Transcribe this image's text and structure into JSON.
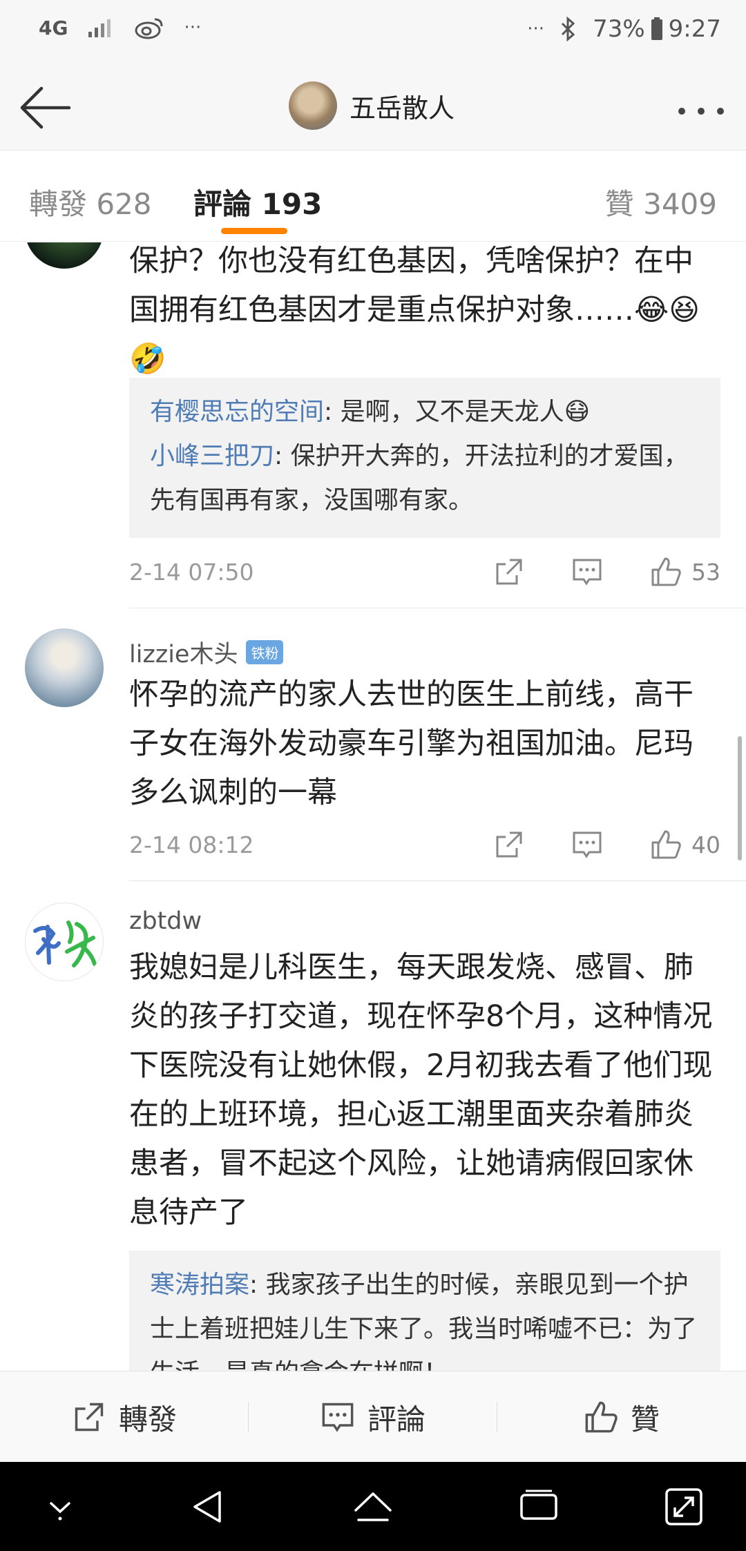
{
  "status_bar": {
    "network": "4G",
    "ellipsis_left": "···",
    "ellipsis_right": "···",
    "battery": "73%",
    "time": "9:27"
  },
  "header": {
    "title": "五岳散人"
  },
  "tabs": [
    {
      "label": "轉發 628"
    },
    {
      "label": "評論 193"
    },
    {
      "label": "贊 3409"
    }
  ],
  "comments": [
    {
      "text": "保护？你也没有红色基因，凭啥保护？在中国拥有红色基因才是重点保护对象……😂😆🤣",
      "replies": [
        {
          "name": "有樱思忘的空间",
          "text": ": 是啊，又不是天龙人😷"
        },
        {
          "name": "小峰三把刀",
          "text": ": 保护开大奔的，开法拉利的才爱国，先有国再有家，没国哪有家。"
        }
      ],
      "time": "2-14 07:50",
      "likes": "53"
    },
    {
      "username": "lizzie木头",
      "badge": "铁粉",
      "text": "怀孕的流产的家人去世的医生上前线，高干子女在海外发动豪车引擎为祖国加油。尼玛多么讽刺的一幕",
      "time": "2-14 08:12",
      "likes": "40"
    },
    {
      "username": "zbtdw",
      "text": "我媳妇是儿科医生，每天跟发烧、感冒、肺炎的孩子打交道，现在怀孕8个月，这种情况下医院没有让她休假，2月初我去看了他们现在的上班环境，担心返工潮里面夹杂着肺炎患者，冒不起这个风险，让她请病假回家休息待产了",
      "replies": [
        {
          "name": "寒涛拍案",
          "text": ": 我家孩子出生的时候，亲眼见到一个护士上着班把娃儿生下来了。我当时唏嘘不已：为了生活，是真的拿命在拼啊！"
        }
      ]
    }
  ],
  "bottom_bar": {
    "repost": "轉發",
    "comment": "評論",
    "like": "贊"
  },
  "colors": {
    "accent": "#ff8200",
    "link": "#4f7cb4"
  }
}
